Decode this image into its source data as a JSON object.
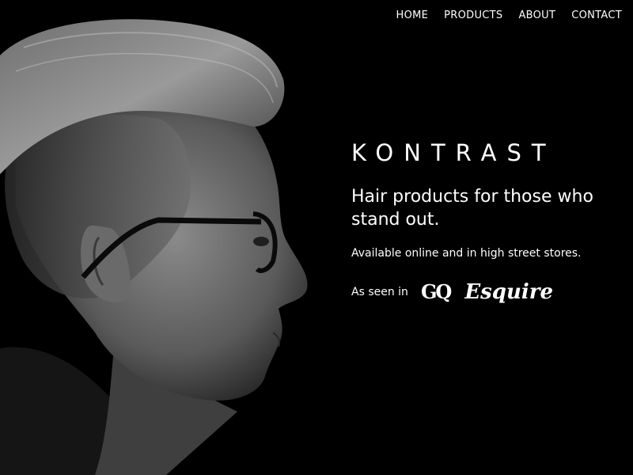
{
  "nav": {
    "items": [
      {
        "label": "HOME"
      },
      {
        "label": "PRODUCTS"
      },
      {
        "label": "ABOUT"
      },
      {
        "label": "CONTACT"
      }
    ]
  },
  "hero": {
    "brand": "KONTRAST",
    "tagline": "Hair products for those who stand out.",
    "availability": "Available online and in high street stores.",
    "seen_in_label": "As seen in",
    "press_logos": [
      {
        "name": "GQ",
        "icon": "gq-logo"
      },
      {
        "name": "Esquire",
        "icon": "esquire-logo"
      }
    ],
    "image": {
      "subject": "black-and-white profile portrait of a man with a pompadour haircut wearing glasses",
      "icon": "portrait-photo"
    }
  },
  "colors": {
    "background": "#000000",
    "text": "#ffffff"
  }
}
